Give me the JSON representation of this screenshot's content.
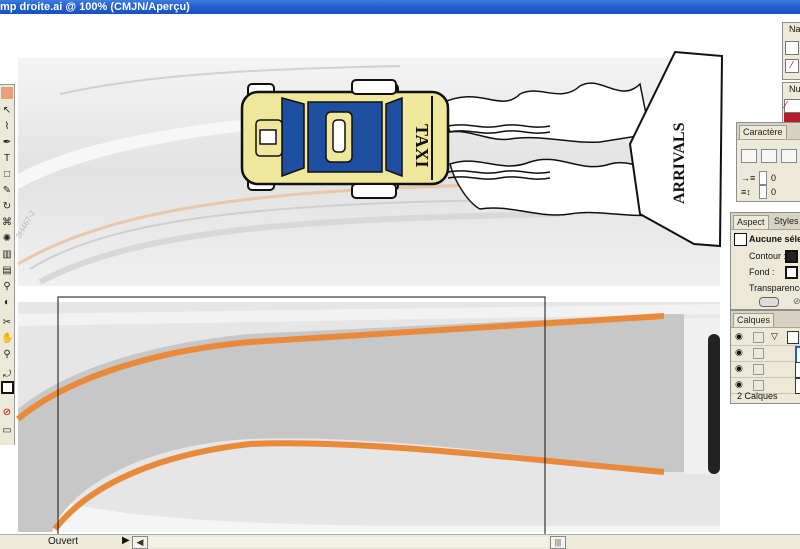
{
  "window": {
    "title": "mp droite.ai @ 100% (CMJN/Aperçu)"
  },
  "artwork": {
    "taxi_label": "TAXI",
    "sign_label": "ARRIVALS"
  },
  "panels": {
    "caractere": {
      "tab_label": "Caractère",
      "field_a": "0",
      "field_b": "0"
    },
    "aspect": {
      "tabs": [
        "Aspect",
        "Styles g"
      ],
      "selection_label": "Aucune séle",
      "contour_label": "Contour :",
      "fond_label": "Fond :",
      "transparence_label": "Transparence"
    },
    "calques": {
      "tab_label": "Calques",
      "count_label": "2 Calques"
    },
    "top": {
      "label_a": "Na",
      "label_b": "Nu"
    }
  },
  "statusbar": {
    "status_text": "Ouvert"
  },
  "colors": {
    "orange_stripe": "#e98a3b",
    "gray_fill": "#c6c7c6",
    "taxi_yellow": "#efe79b",
    "taxi_blue": "#1f4fa0"
  }
}
